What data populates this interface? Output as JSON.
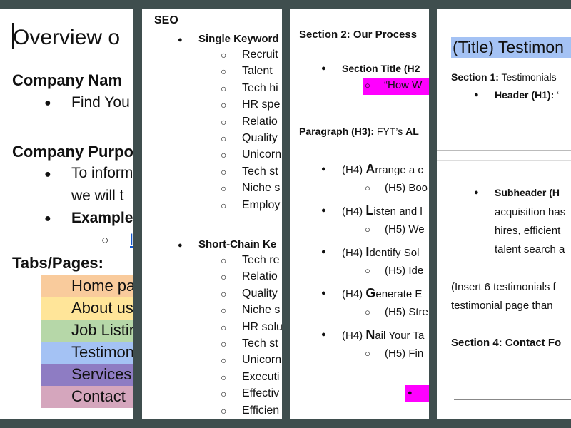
{
  "page1": {
    "title": "Overview o",
    "company_name_heading": "Company Nam",
    "company_name_value": "Find You",
    "purpose_heading": "Company Purpo",
    "purpose_line1": "To inform",
    "purpose_line2": "we will t",
    "example_label": "Example",
    "example_link": "l",
    "tabs_heading": "Tabs/Pages:",
    "tabs": [
      {
        "label": "Home pa",
        "color": "#f9cb9c"
      },
      {
        "label": "About us",
        "color": "#ffe599"
      },
      {
        "label": "Job Listin",
        "color": "#b6d7a8"
      },
      {
        "label": "Testimon",
        "color": "#a4c2f4"
      },
      {
        "label": "Services",
        "color": "#8e7cc3"
      },
      {
        "label": "Contact",
        "color": "#d5a6bd"
      }
    ]
  },
  "page2": {
    "heading": "SEO",
    "single_keyword_label": "Single Keyword",
    "single_keywords": [
      "Recruit",
      "Talent",
      "Tech hi",
      "HR spe",
      "Relatio",
      "Quality",
      "Unicorn",
      "Tech st",
      "Niche s",
      "Employ"
    ],
    "short_chain_label": "Short-Chain Ke",
    "short_chain_keywords": [
      "Tech re",
      "Relatio",
      "Quality",
      "Niche s",
      "HR solu",
      "Tech st",
      "Unicorn",
      "Executi",
      "Effectiv",
      "Efficien"
    ]
  },
  "page3": {
    "section_heading": "Section 2: Our Process",
    "section_title_label": "Section Title (H2",
    "section_title_value": "“How W",
    "paragraph_label": "Paragraph (H3):",
    "paragraph_value_plain": " FYT’s ",
    "paragraph_value_bold": "AL",
    "steps": [
      {
        "h4_prefix": "(H4) ",
        "letter": "A",
        "h4_rest": "rrange a c",
        "h5": "(H5) Boo"
      },
      {
        "h4_prefix": "(H4) ",
        "letter": "L",
        "h4_rest": "isten and l",
        "h5": "(H5) We"
      },
      {
        "h4_prefix": "(H4) ",
        "letter": "I",
        "h4_rest": "dentify Sol",
        "h5": "(H5) Ide"
      },
      {
        "h4_prefix": "(H4) ",
        "letter": "G",
        "h4_rest": "enerate E",
        "h5": "(H5) Stre"
      },
      {
        "h4_prefix": "(H4) ",
        "letter": "N",
        "h4_rest": "ail Your Ta",
        "h5": "(H5) Fin"
      }
    ],
    "highlight_color": "#ff00ff"
  },
  "page4": {
    "title": "(Title) Testimon",
    "title_bg": "#a4c2f4",
    "section1_label": "Section 1:",
    "section1_value": " Testimonials",
    "header_label": "Header (H1):",
    "header_value": " ‘",
    "subheader_label": "Subheader (H",
    "sub_lines": [
      "acquisition has",
      "hires, efficient",
      "talent search a"
    ],
    "insert_line1": "(Insert 6 testimonials f",
    "insert_line2": "testimonial page than",
    "section4": "Section 4: Contact Fo"
  }
}
